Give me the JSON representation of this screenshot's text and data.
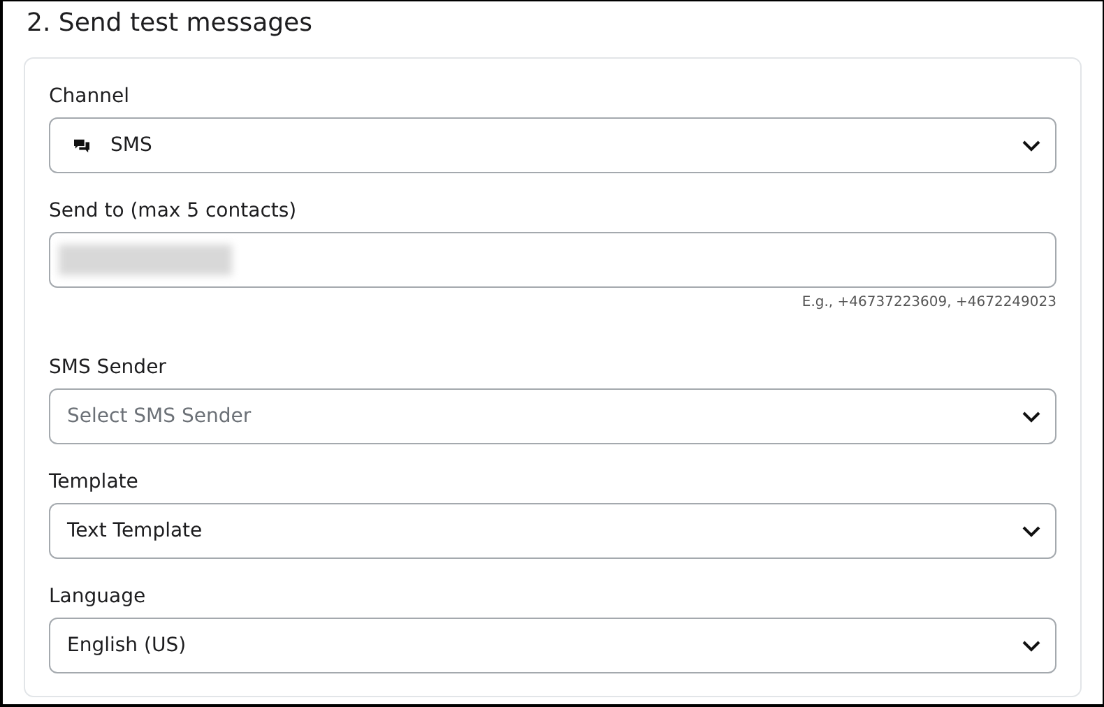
{
  "section_title": "2. Send test messages",
  "fields": [
    {
      "label": "Channel",
      "kind": "icon_select",
      "value": "SMS"
    },
    {
      "label": "Send to (max 5 contacts)",
      "kind": "text",
      "redacted": true,
      "hint": "E.g., +46737223609, +4672249023"
    },
    {
      "label": "SMS Sender",
      "kind": "select",
      "placeholder": "Select SMS Sender"
    },
    {
      "label": "Template",
      "kind": "select",
      "value": "Text Template"
    },
    {
      "label": "Language",
      "kind": "select",
      "value": "English (US)"
    }
  ]
}
